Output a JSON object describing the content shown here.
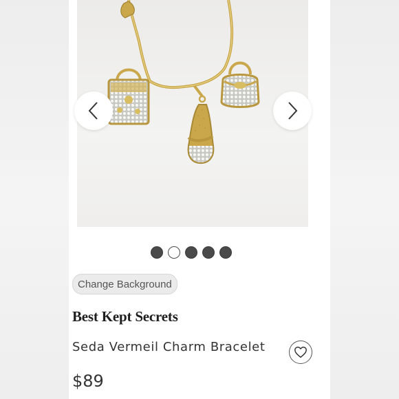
{
  "carousel": {
    "image_alt": "Gold chain bracelet with three pavé charms: a handbag, a flip-flop sandal and a purse",
    "prev_icon": "chevron-left-icon",
    "next_icon": "chevron-right-icon",
    "slide_count": 5,
    "active_slide": 2
  },
  "product": {
    "change_background_label": "Change Background",
    "brand": "Best Kept Secrets",
    "title": "Seda Vermeil Charm Bracelet",
    "price": "$89",
    "like_icon": "heart-icon"
  },
  "colors": {
    "dot_filled": "#4a4a4a",
    "dot_active": "#ffffff",
    "chain_gold": "#c9a74a"
  }
}
